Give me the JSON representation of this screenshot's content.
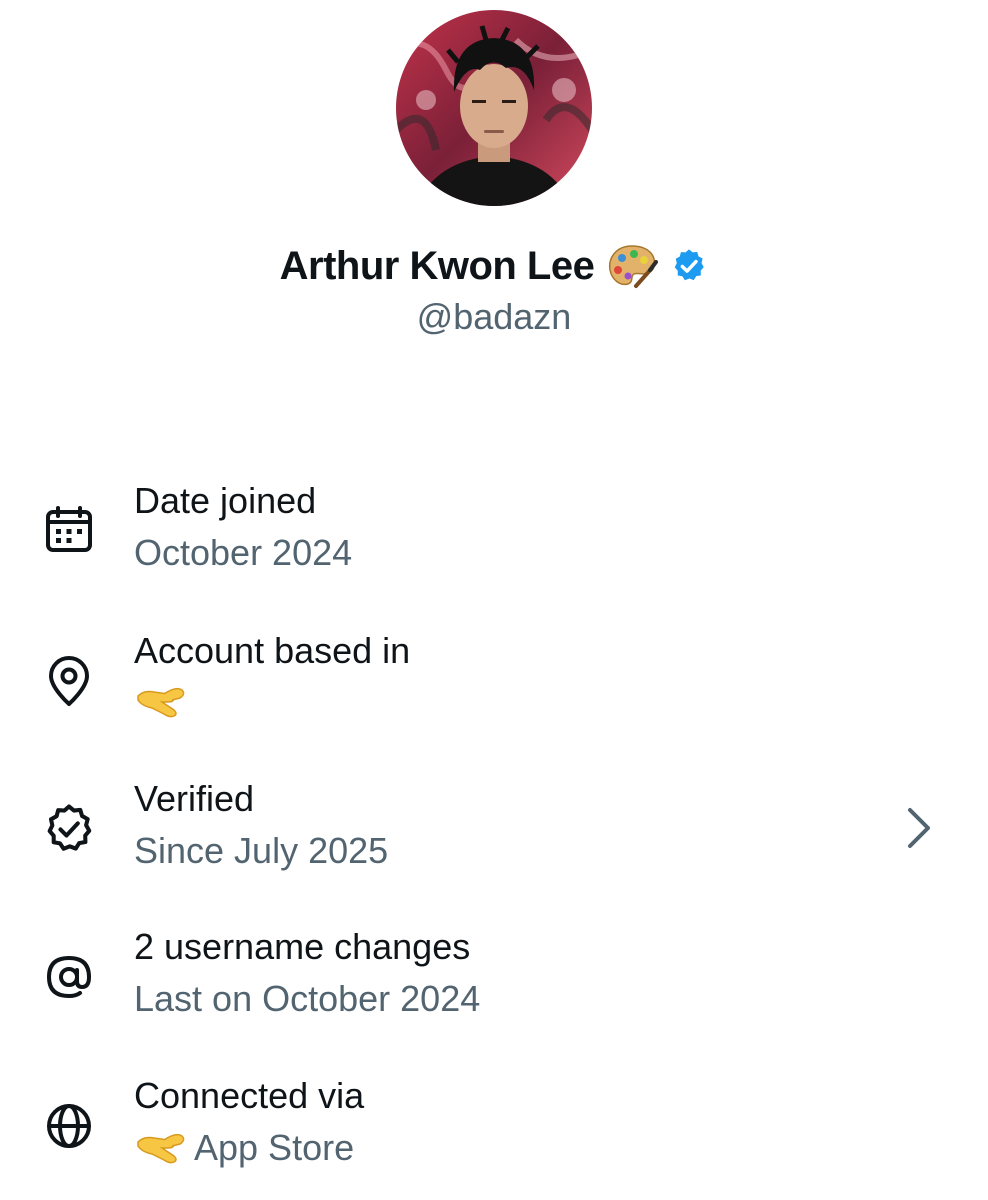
{
  "profile": {
    "display_name": "Arthur Kwon Lee",
    "handle": "@badazn",
    "name_emoji_icon": "artist-palette-icon",
    "verified_badge_icon": "verified-badge-icon",
    "verified_badge_color": "#1d9bf0"
  },
  "about": [
    {
      "title": "Date joined",
      "subtitle": "October 2024",
      "icon": "calendar-icon"
    },
    {
      "title": "Account based in",
      "subtitle": "",
      "subtitle_emoji": "pinching-hand-icon",
      "icon": "location-pin-icon"
    },
    {
      "title": "Verified",
      "subtitle": "Since July 2025",
      "icon": "verified-outline-icon",
      "has_chevron": true
    },
    {
      "title": "2 username changes",
      "subtitle": "Last on October 2024",
      "icon": "at-sign-icon"
    },
    {
      "title": "Connected via",
      "subtitle": "App Store",
      "subtitle_emoji": "pinching-hand-icon",
      "icon": "globe-icon"
    }
  ],
  "colors": {
    "primary_text": "#0f1419",
    "secondary_text": "#536471",
    "accent": "#1d9bf0"
  }
}
